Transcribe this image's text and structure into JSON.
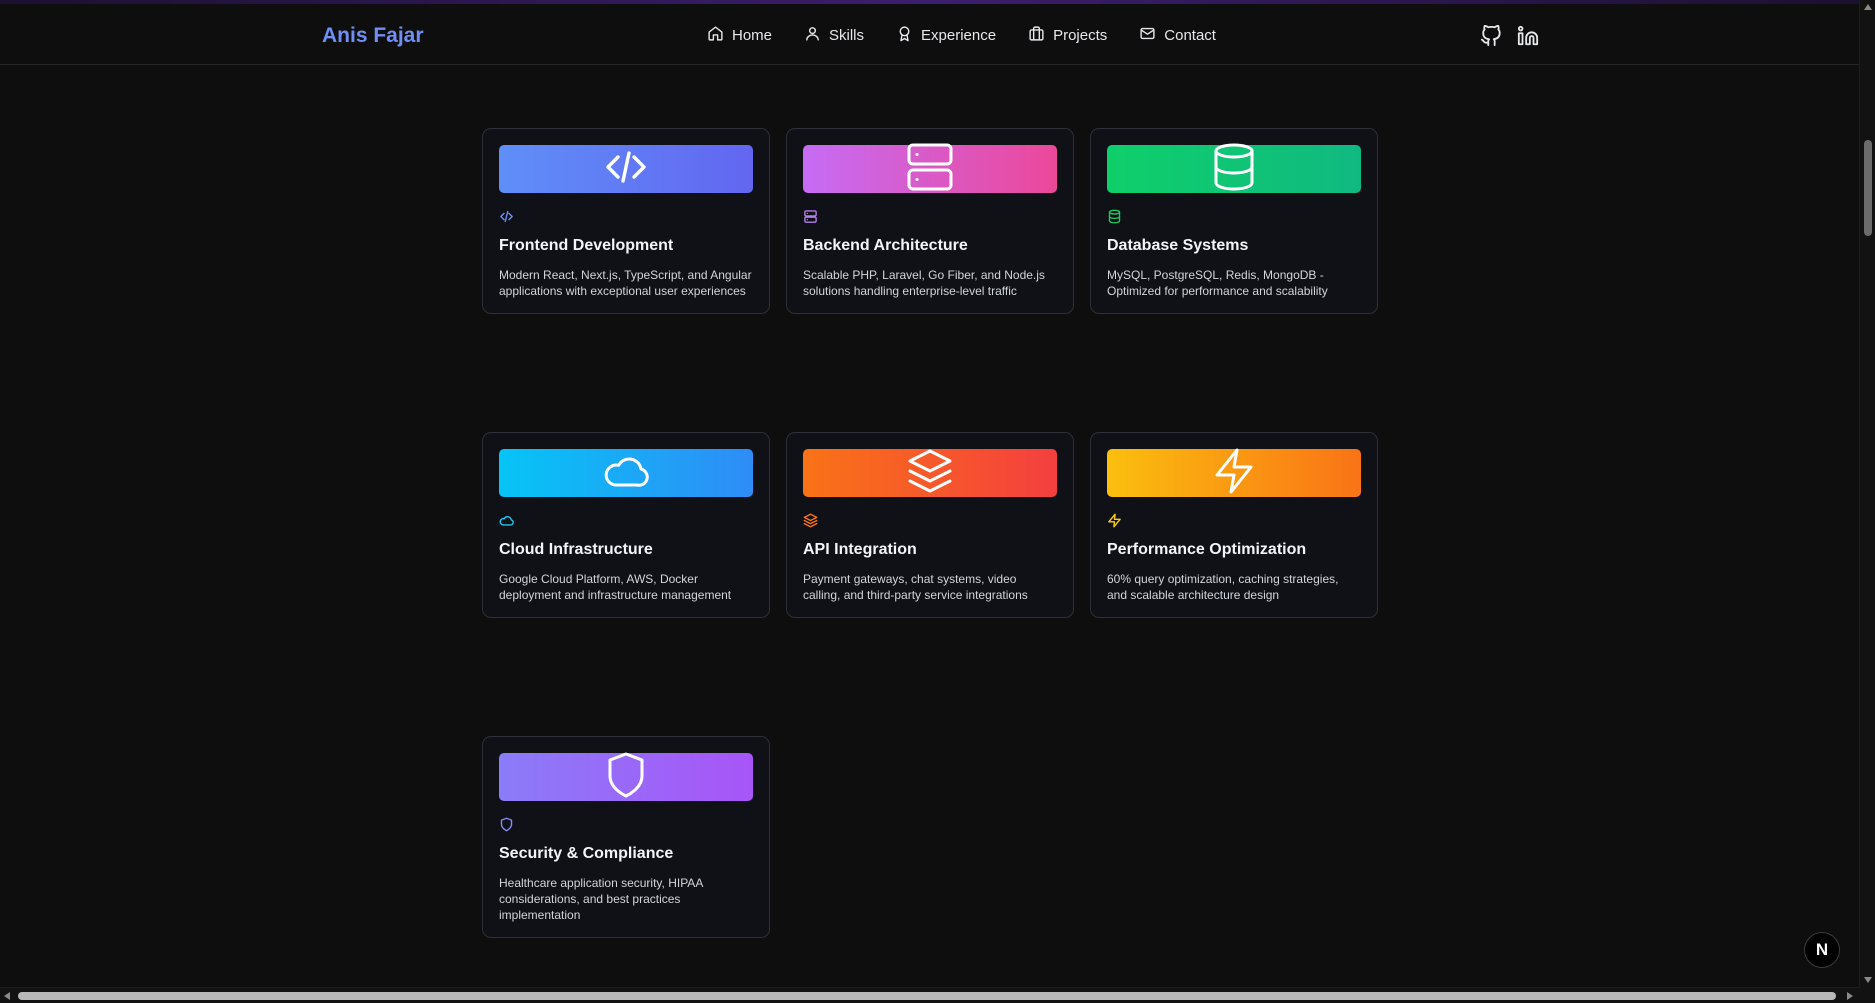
{
  "brand": "Anis Fajar",
  "nav": [
    {
      "label": "Home",
      "icon": "home-icon"
    },
    {
      "label": "Skills",
      "icon": "user-icon"
    },
    {
      "label": "Experience",
      "icon": "award-icon"
    },
    {
      "label": "Projects",
      "icon": "briefcase-icon"
    },
    {
      "label": "Contact",
      "icon": "mail-icon"
    }
  ],
  "social": [
    {
      "icon": "github-icon"
    },
    {
      "icon": "linkedin-icon"
    }
  ],
  "cards": [
    {
      "title": "Frontend Development",
      "desc": "Modern React, Next.js, TypeScript, and Angular applications with exceptional user experiences",
      "icon": "code-icon",
      "gradient": [
        "#5f8ff8",
        "#6366f1"
      ],
      "accent": "#6f8ff5"
    },
    {
      "title": "Backend Architecture",
      "desc": "Scalable PHP, Laravel, Go Fiber, and Node.js solutions handling enterprise-level traffic",
      "icon": "server-icon",
      "gradient": [
        "#c66cf5",
        "#ec4899"
      ],
      "accent": "#b77cf0"
    },
    {
      "title": "Database Systems",
      "desc": "MySQL, PostgreSQL, Redis, MongoDB - Optimized for performance and scalability",
      "icon": "database-icon",
      "gradient": [
        "#0fcf6a",
        "#10b981"
      ],
      "accent": "#22c55e"
    },
    {
      "title": "Cloud Infrastructure",
      "desc": "Google Cloud Platform, AWS, Docker deployment and infrastructure management",
      "icon": "cloud-icon",
      "gradient": [
        "#06c5f5",
        "#2f8cf7"
      ],
      "accent": "#22c7ef"
    },
    {
      "title": "API Integration",
      "desc": "Payment gateways, chat systems, video calling, and third-party service integrations",
      "icon": "layers-icon",
      "gradient": [
        "#f97316",
        "#f43f3f"
      ],
      "accent": "#f97316"
    },
    {
      "title": "Performance Optimization",
      "desc": "60% query optimization, caching strategies, and scalable architecture design",
      "icon": "zap-icon",
      "gradient": [
        "#fbbf0e",
        "#f97316"
      ],
      "accent": "#facc15"
    },
    {
      "title": "Security & Compliance",
      "desc": "Healthcare application security, HIPAA considerations, and best practices implementation",
      "icon": "shield-icon",
      "gradient": [
        "#8b7cf8",
        "#a855f7"
      ],
      "accent": "#818cf8"
    }
  ],
  "badge": "N"
}
